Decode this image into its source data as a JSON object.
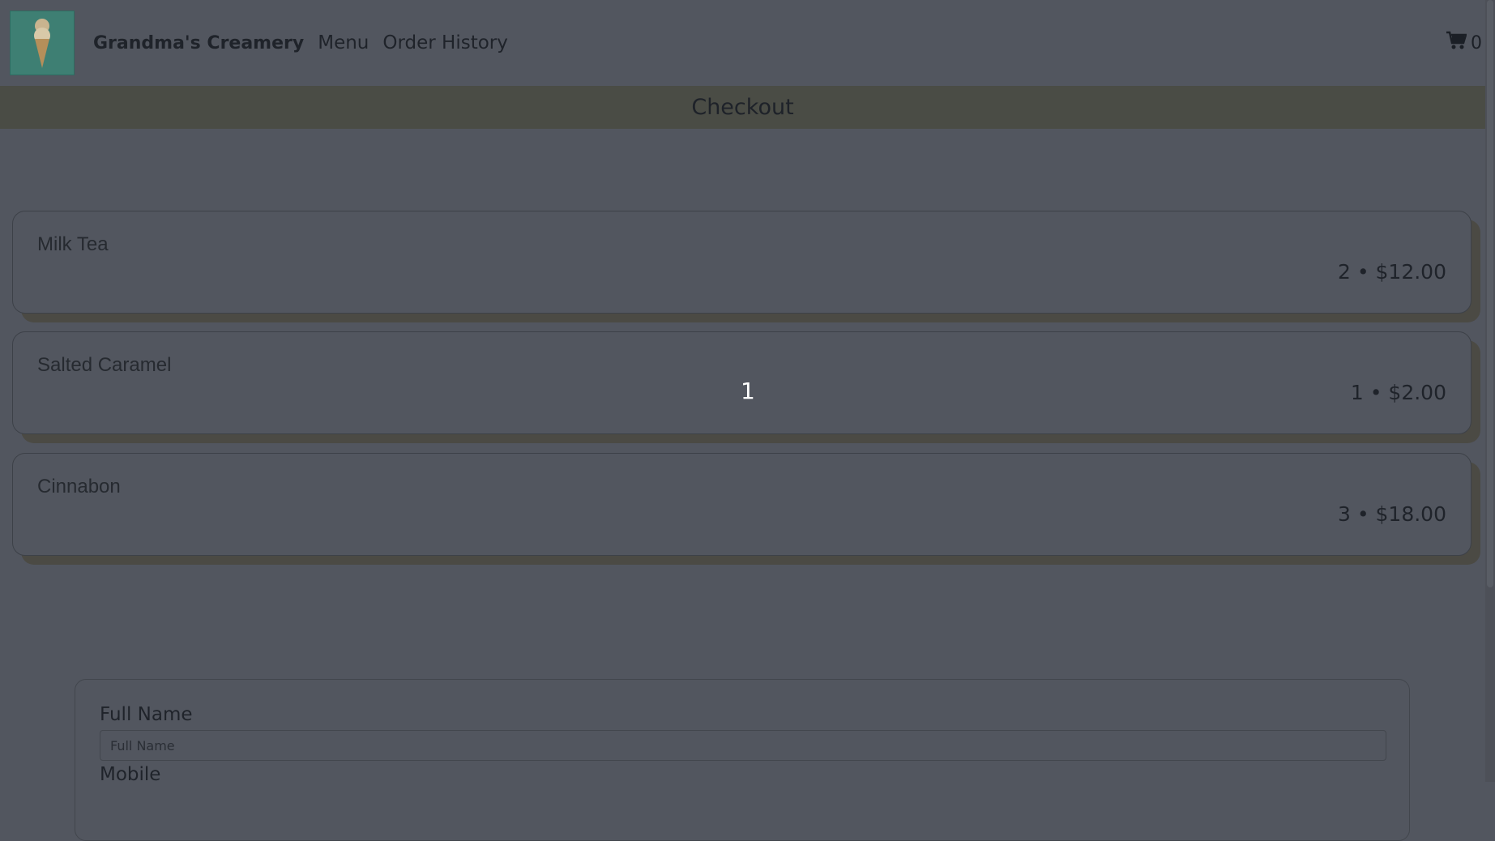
{
  "navbar": {
    "brand": "Grandma's Creamery",
    "links": [
      "Menu",
      "Order History"
    ],
    "cart_count": "0",
    "logo_icon": "ice-cream-cone-icon",
    "cart_icon": "shopping-cart-icon"
  },
  "banner": {
    "title": "Checkout"
  },
  "cart_items": [
    {
      "name": "Milk Tea",
      "summary": "2 • $12.00"
    },
    {
      "name": "Salted Caramel",
      "summary": "1 • $2.00"
    },
    {
      "name": "Cinnabon",
      "summary": "3 • $18.00"
    }
  ],
  "overlay": {
    "label": "1"
  },
  "form": {
    "full_name_label": "Full Name",
    "full_name_placeholder": "Full Name",
    "full_name_value": "",
    "mobile_label": "Mobile"
  },
  "colors": {
    "background": "#52565f",
    "banner": "#4a4c45",
    "card_shadow": "#4b4a44"
  }
}
